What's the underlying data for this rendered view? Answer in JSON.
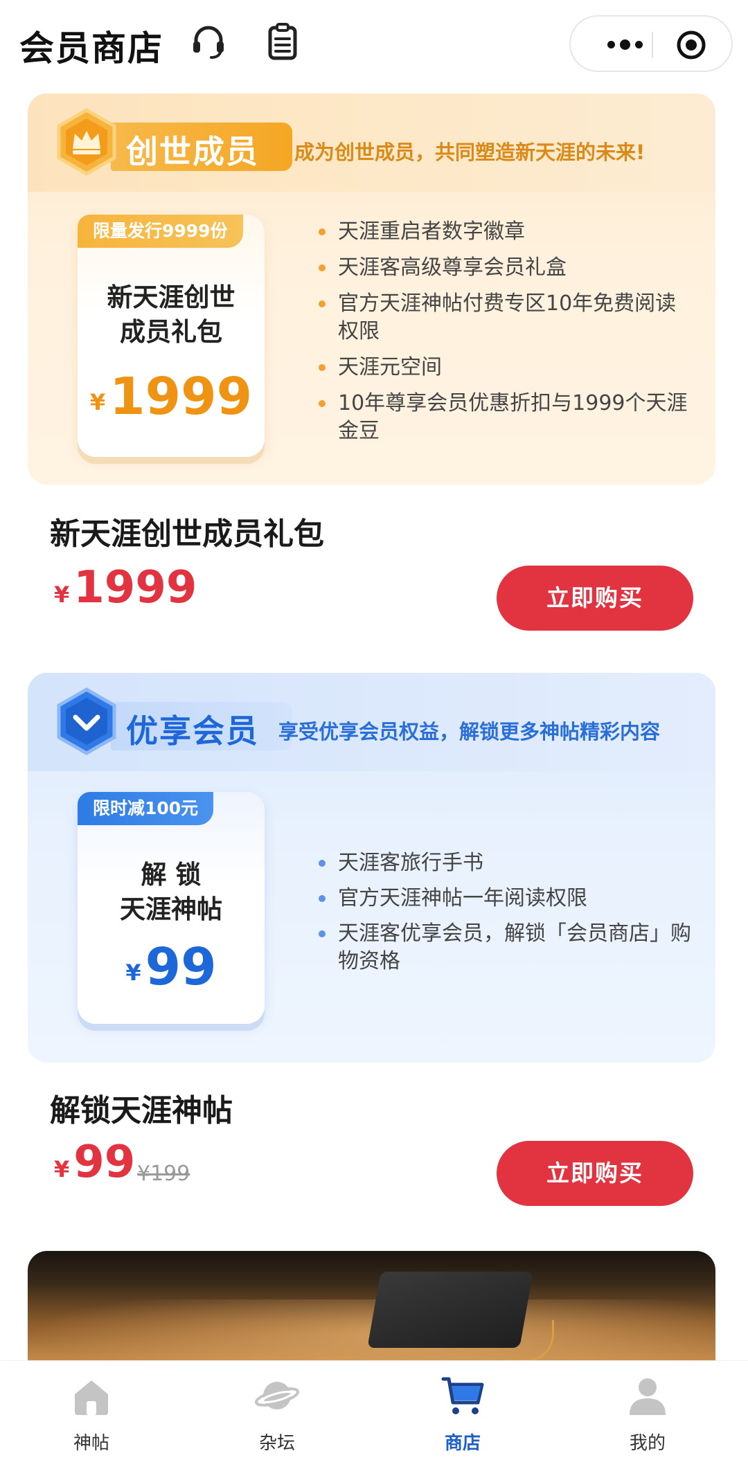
{
  "header": {
    "title": "会员商店",
    "icons": [
      "headset-icon",
      "notes-icon",
      "more-dots-icon",
      "target-icon"
    ]
  },
  "cards": [
    {
      "tier": "创世成员",
      "tagline": "成为创世成员，共同塑造新天涯的未来!",
      "ribbon": "限量发行9999份",
      "pack_name_line1": "新天涯创世",
      "pack_name_line2": "成员礼包",
      "pack_currency": "¥",
      "pack_price": "1999",
      "perks": [
        "天涯重启者数字徽章",
        "天涯客高级尊享会员礼盒",
        "官方天涯神帖付费专区10年免费阅读权限",
        "天涯元空间",
        "10年尊享会员优惠折扣与1999个天涯金豆"
      ],
      "product_name": "新天涯创世成员礼包",
      "currency": "¥",
      "price": "1999",
      "original_price": "",
      "buy_label": "立即购买",
      "accent_color": "#f5a623"
    },
    {
      "tier": "优享会员",
      "tagline": "享受优享会员权益，解锁更多神帖精彩内容",
      "ribbon": "限时减100元",
      "pack_name_line1": "解 锁",
      "pack_name_line2": "天涯神帖",
      "pack_currency": "¥",
      "pack_price": "99",
      "perks": [
        "天涯客旅行手书",
        "官方天涯神帖一年阅读权限",
        "天涯客优享会员，解锁「会员商店」购物资格"
      ],
      "product_name": "解锁天涯神帖",
      "currency": "¥",
      "price": "99",
      "original_price": "¥199",
      "buy_label": "立即购买",
      "accent_color": "#1e67d9"
    }
  ],
  "tabs": [
    {
      "label": "神帖",
      "icon": "home-icon",
      "active": false
    },
    {
      "label": "杂坛",
      "icon": "planet-icon",
      "active": false
    },
    {
      "label": "商店",
      "icon": "cart-icon",
      "active": true
    },
    {
      "label": "我的",
      "icon": "user-icon",
      "active": false
    }
  ],
  "colors": {
    "buy_button": "#e13340",
    "price_red": "#e13340",
    "active_tab": "#1e5fc8"
  }
}
